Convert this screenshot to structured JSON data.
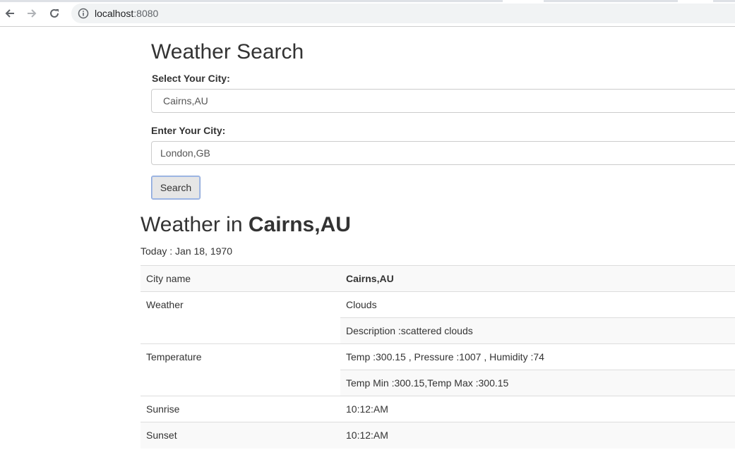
{
  "browser": {
    "url_host": "localhost",
    "url_port": ":8080",
    "icons": [
      "back-arrow-icon",
      "forward-arrow-icon",
      "reload-icon",
      "info-icon"
    ]
  },
  "page": {
    "title": "Weather Search",
    "select_label": "Select Your City:",
    "select_value": "Cairns,AU",
    "enter_label": "Enter Your City:",
    "enter_value": "London,GB",
    "search_button": "Search"
  },
  "result": {
    "heading_prefix": "Weather in",
    "heading_city": "Cairns,AU",
    "today": "Today : Jan 18, 1970",
    "rows": {
      "city_name": {
        "label": "City name",
        "value": "Cairns,AU"
      },
      "weather": {
        "label": "Weather",
        "main": "Clouds",
        "description": "Description :scattered clouds"
      },
      "temperature": {
        "label": "Temperature",
        "line1": "Temp :300.15 , Pressure :1007 , Humidity :74",
        "line2": "Temp Min :300.15,Temp Max :300.15"
      },
      "sunrise": {
        "label": "Sunrise",
        "value": "10:12:AM"
      },
      "sunset": {
        "label": "Sunset",
        "value": "10:12:AM"
      }
    }
  }
}
